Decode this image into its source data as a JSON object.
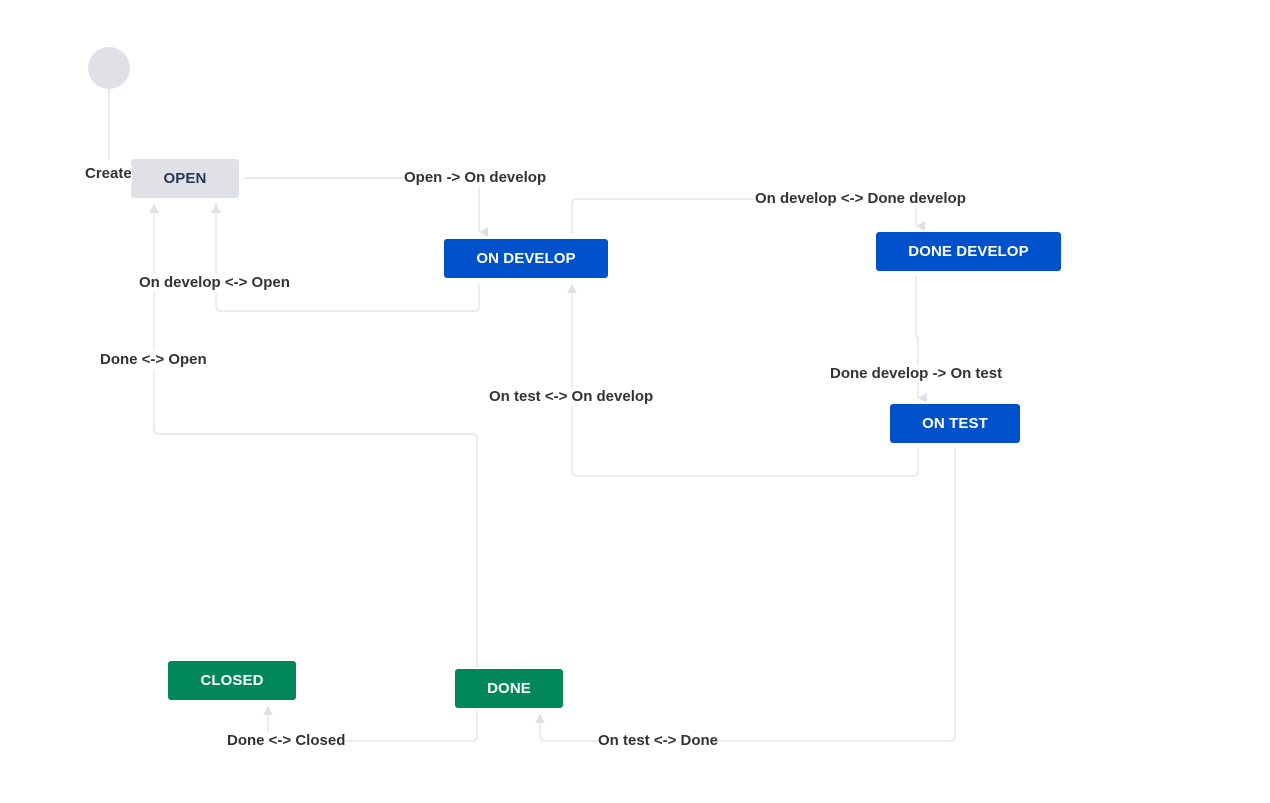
{
  "colors": {
    "todo_bg": "#dfe1e6",
    "todo_text": "#253858",
    "in_progress": "#0052cc",
    "done": "#00875a",
    "edge": "#dfe1e6",
    "label": "#333333"
  },
  "statuses": {
    "open": "OPEN",
    "on_develop": "ON DEVELOP",
    "done_develop": "DONE DEVELOP",
    "on_test": "ON TEST",
    "closed": "CLOSED",
    "done": "DONE"
  },
  "transitions": {
    "create": "Create",
    "open_to_on_develop": "Open -> On develop",
    "on_develop_done_develop": "On develop <-> Done develop",
    "on_develop_open": "On develop <-> Open",
    "done_open": "Done <-> Open",
    "done_develop_to_on_test": "Done develop -> On test",
    "on_test_on_develop": "On test <-> On develop",
    "done_closed": "Done <-> Closed",
    "on_test_done": "On test <-> Done"
  }
}
